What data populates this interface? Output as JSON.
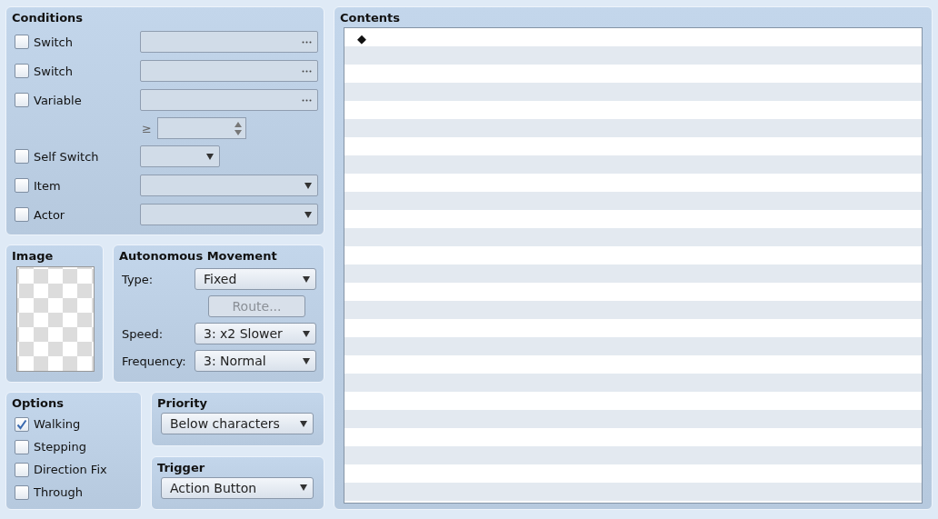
{
  "conditions": {
    "title": "Conditions",
    "rows": [
      {
        "kind": "picker",
        "label": "Switch",
        "checked": false
      },
      {
        "kind": "picker",
        "label": "Switch",
        "checked": false
      },
      {
        "kind": "picker",
        "label": "Variable",
        "checked": false
      },
      {
        "kind": "compare",
        "operator": "≥"
      },
      {
        "kind": "short_dropdown",
        "label": "Self Switch",
        "checked": false
      },
      {
        "kind": "dropdown",
        "label": "Item",
        "checked": false
      },
      {
        "kind": "dropdown",
        "label": "Actor",
        "checked": false
      }
    ]
  },
  "image": {
    "title": "Image"
  },
  "movement": {
    "title": "Autonomous Movement",
    "type": {
      "label": "Type:",
      "value": "Fixed"
    },
    "route": {
      "label": "Route...",
      "disabled": true
    },
    "speed": {
      "label": "Speed:",
      "value": "3: x2 Slower"
    },
    "frequency": {
      "label": "Frequency:",
      "value": "3: Normal"
    }
  },
  "options": {
    "title": "Options",
    "items": [
      {
        "label": "Walking",
        "checked": true
      },
      {
        "label": "Stepping",
        "checked": false
      },
      {
        "label": "Direction Fix",
        "checked": false
      },
      {
        "label": "Through",
        "checked": false
      }
    ]
  },
  "priority": {
    "title": "Priority",
    "value": "Below characters"
  },
  "trigger": {
    "title": "Trigger",
    "value": "Action Button"
  },
  "contents": {
    "title": "Contents",
    "lines": [
      {
        "text": "◆"
      }
    ]
  }
}
